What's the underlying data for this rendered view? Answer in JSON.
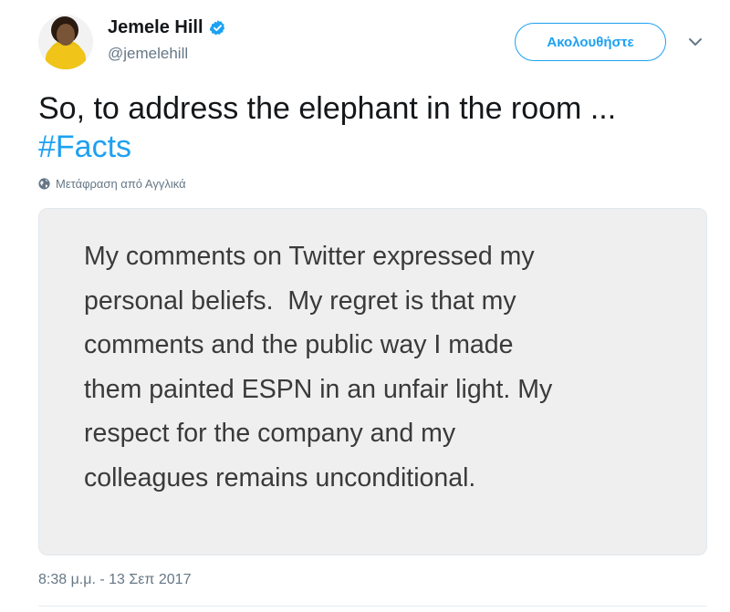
{
  "author": {
    "display_name": "Jemele Hill",
    "handle": "@jemelehill",
    "verified": true,
    "avatar_icon": "profile-photo"
  },
  "actions": {
    "follow_label": "Ακολουθήστε",
    "more_icon": "chevron-down-icon"
  },
  "tweet": {
    "text_line_1": "So, to address the elephant in the room ...",
    "hashtag": "#Facts",
    "translate_label": "Μετάφραση από Αγγλικά",
    "translate_icon": "globe-icon",
    "timestamp": "8:38 μ.μ. - 13 Σεπ 2017"
  },
  "image_statement": {
    "lines": [
      "My comments on Twitter expressed my",
      "personal beliefs.  My regret is that my",
      "comments and the public way I made",
      "them painted ESPN in an unfair light. My",
      "respect for the company and my",
      "colleagues remains unconditional."
    ]
  },
  "colors": {
    "accent": "#1da1f2",
    "secondary_text": "#657786",
    "primary_text": "#14171a",
    "card_background": "#efefef"
  }
}
